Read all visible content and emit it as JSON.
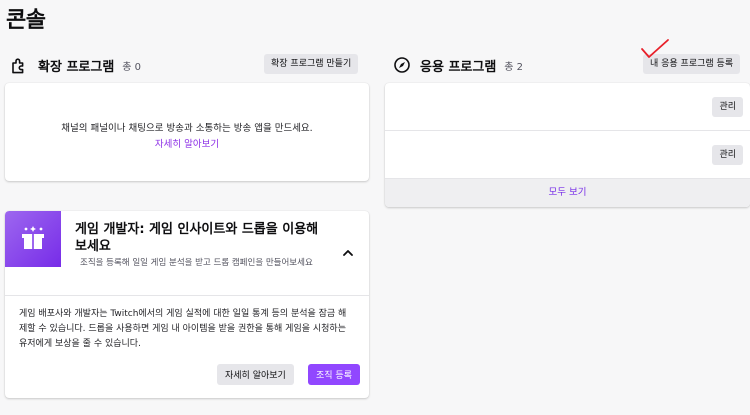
{
  "page": {
    "title": "콘솔"
  },
  "extensions": {
    "title": "확장 프로그램",
    "count": "총 0",
    "create_button": "확장 프로그램 만들기",
    "empty_text": "채널의 패널이나 채팅으로 방송과 소통하는 방송 앱을 만드세요.",
    "learn_more": "자세히 알아보기",
    "icon": "puzzle-icon"
  },
  "apps": {
    "title": "응용 프로그램",
    "count": "총 2",
    "register_button": "내 응용 프로그램 등록",
    "rows": [
      {
        "manage_label": "관리"
      },
      {
        "manage_label": "관리"
      }
    ],
    "view_all": "모두 보기",
    "icon": "compass-icon"
  },
  "developer": {
    "title": "게임 개발자: 게임 인사이트와 드롭을 이용해보세요",
    "subtitle": "조직을 등록해 일일 게임 분석을 받고 드롭 캠페인을 만들어보세요",
    "body": "게임 배포사와 개발자는 Twitch에서의 게임 실적에 대한 일일 통계 등의 분석을 잠금 해제할 수 있습니다. 드롭을 사용하면 게임 내 아이템을 받을 권한을 통해 게임을 시청하는 유저에게 보상을 줄 수 있습니다.",
    "learn_button": "자세히 알아보기",
    "register_org_button": "조직 등록",
    "icon": "gift-box-icon"
  },
  "colors": {
    "accent": "#9147ff",
    "link": "#8c2fe6",
    "annotation": "#e8202a"
  }
}
